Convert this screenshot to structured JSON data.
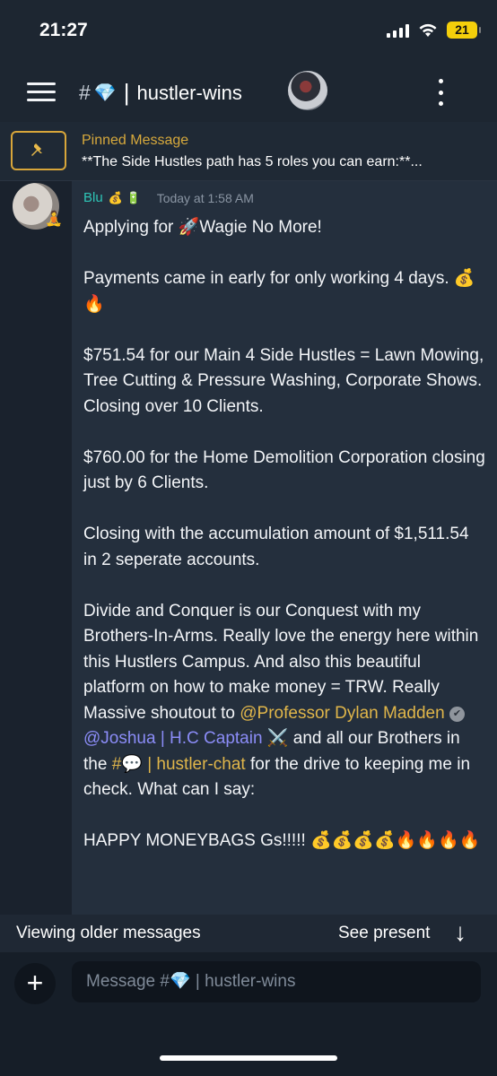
{
  "status": {
    "time": "21:27",
    "battery": "21"
  },
  "header": {
    "hash": "#",
    "gem": "💎",
    "separator": "|",
    "channel_name": "hustler-wins"
  },
  "pinned": {
    "title": "Pinned Message",
    "text": "**The Side Hustles path has 5 roles you can earn:**..."
  },
  "message": {
    "username": "Blu",
    "name_emojis": "💰 🔋",
    "timestamp": "Today at 1:58 AM",
    "p1": "Applying for 🚀Wagie No More!",
    "p2": "Payments came in early for only working 4 days. 💰🔥",
    "p3": "$751.54 for our Main 4 Side Hustles = Lawn Mowing, Tree Cutting & Pressure Washing, Corporate Shows. Closing over 10 Clients.",
    "p4": "$760.00 for the Home Demolition Corporation closing just by 6 Clients.",
    "p5": "Closing with the accumulation amount of $1,511.54 in 2 seperate accounts.",
    "p6_a": "Divide and Conquer is our Conquest with my Brothers-In-Arms. Really love the energy here within this Hustlers Campus. And also this beautiful platform on how to make money = TRW. Really Massive shoutout to",
    "mention1": "@Professor Dylan Madden",
    "verified": "✔",
    "mention2": "@Joshua | H.C Captain",
    "mention2_emoji": "⚔️",
    "p6_b": " and all our Brothers in the ",
    "channel_link": "#💬 | hustler-chat",
    "p6_c": " for the drive to keeping me in check. What can I say:",
    "p7": "HAPPY MONEYBAGS Gs!!!!! 💰💰💰💰🔥🔥🔥🔥"
  },
  "footer": {
    "viewing_older": "Viewing older messages",
    "see_present": "See present",
    "down_arrow": "↓",
    "add": "+",
    "input_placeholder": "Message #💎 | hustler-wins"
  },
  "icons": {
    "menu": "hamburger-icon",
    "more": "kebab-icon",
    "pin": "pin-icon",
    "add": "plus-icon",
    "down": "arrow-down-icon"
  },
  "colors": {
    "username": "#2ec4b6",
    "pinned_title": "#d7a93c",
    "mention_gold": "#e0b64a",
    "mention_purple": "#8b8cf7",
    "battery": "#f4cf0b"
  }
}
